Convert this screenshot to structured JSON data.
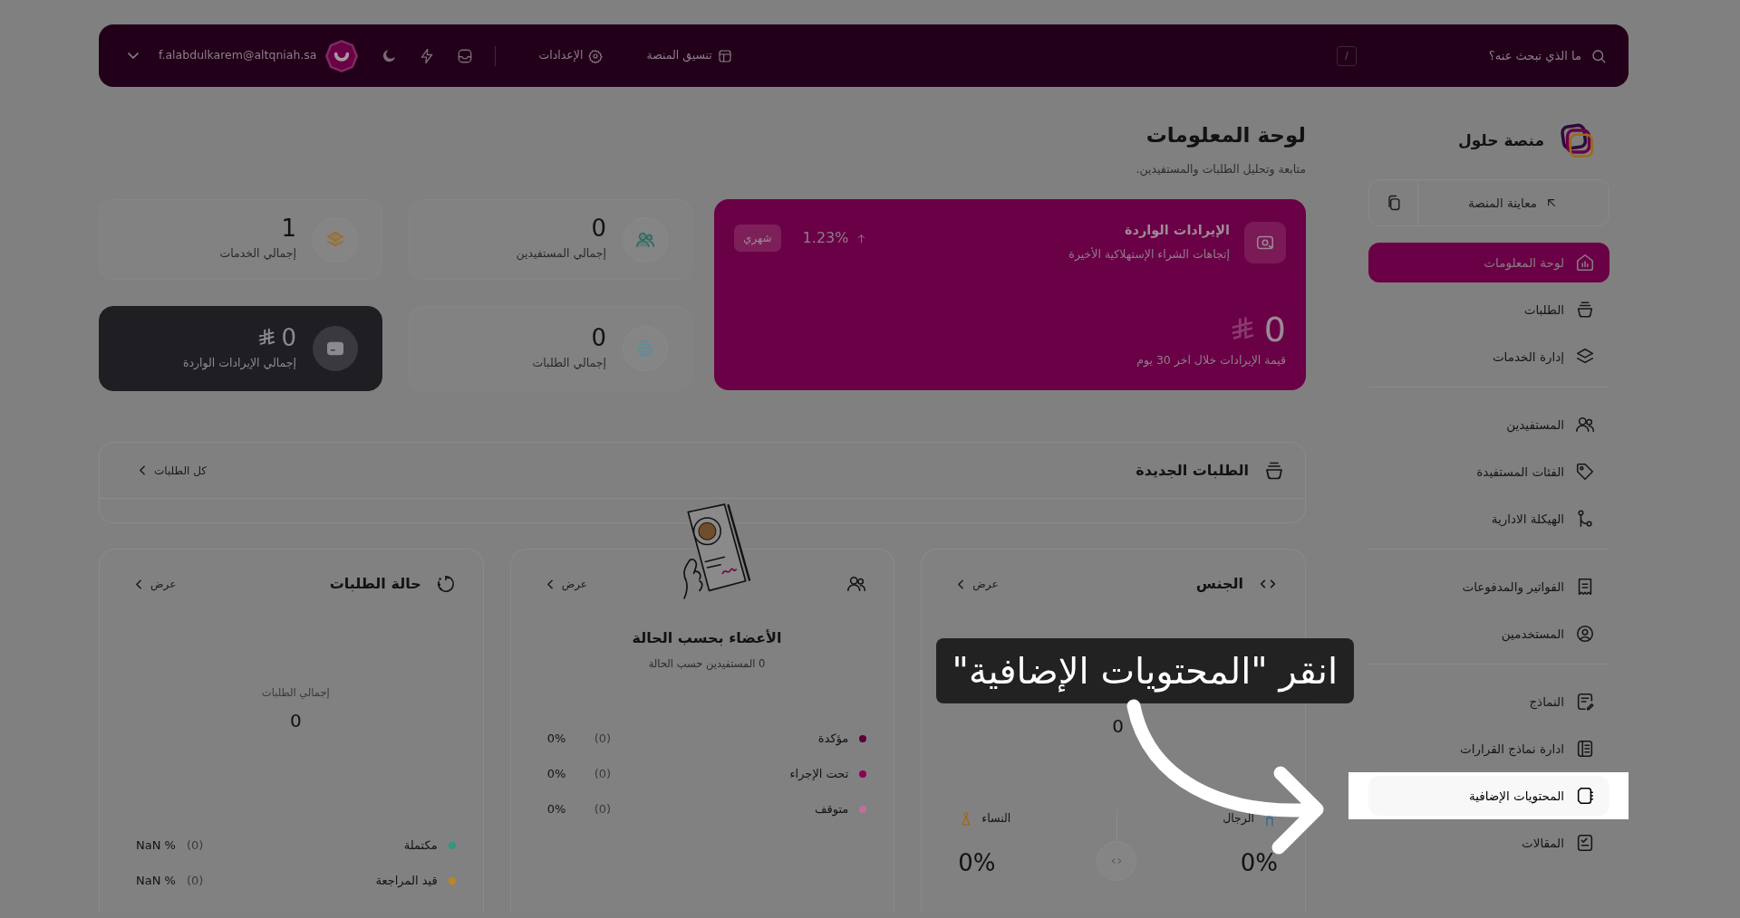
{
  "top_bar": {
    "search": {
      "placeholder": "ما الذي تبحث عنه؟"
    },
    "shortcut_key": "/",
    "links": [
      {
        "label": "تنسيق المنصة"
      },
      {
        "label": "الإعدادات"
      }
    ],
    "user": {
      "email": "f.alabdulkarem@altqniah.sa"
    }
  },
  "sidebar": {
    "brand": "منصة حلول",
    "preview_button": "معاينة المنصة",
    "groups": [
      {
        "items": [
          {
            "label": "لوحة المعلومات",
            "selected": true,
            "highlighted": false
          },
          {
            "label": "الطلبات",
            "selected": false,
            "highlighted": false
          },
          {
            "label": "إدارة الخدمات",
            "selected": false,
            "highlighted": false
          }
        ]
      },
      {
        "items": [
          {
            "label": "المستفيدين",
            "selected": false,
            "highlighted": false
          },
          {
            "label": "الفئات المستفيدة",
            "selected": false,
            "highlighted": false
          },
          {
            "label": "الهيكلة الادارية",
            "selected": false,
            "highlighted": false
          }
        ]
      },
      {
        "items": [
          {
            "label": "الفواتير والمدفوعات",
            "selected": false,
            "highlighted": false
          },
          {
            "label": "المستخدمين",
            "selected": false,
            "highlighted": false
          }
        ]
      },
      {
        "items": [
          {
            "label": "النماذج",
            "selected": false,
            "highlighted": false
          },
          {
            "label": "ادارة نماذج القرارات",
            "selected": false,
            "highlighted": false
          },
          {
            "label": "المحتويات الإضافية",
            "selected": false,
            "highlighted": true
          },
          {
            "label": "المقالات",
            "selected": false,
            "highlighted": false
          }
        ]
      }
    ]
  },
  "page": {
    "title": "لوحة المعلومات",
    "subtitle": "متابعة وتحليل الطلبات والمستفيدين."
  },
  "revenue_card": {
    "title": "الإيرادات الواردة",
    "subtitle": "إتجاهات الشراء الإستهلاكية الأخيرة",
    "change": "1.23%",
    "period": "شهري",
    "value": "0",
    "caption": "قيمة الإيرادات خلال اخر 30 يوم"
  },
  "stats": [
    {
      "kind": "count",
      "value": "0",
      "label": "إجمالي المستفيدين"
    },
    {
      "kind": "count",
      "value": "1",
      "label": "إجمالي الخدمات"
    },
    {
      "kind": "count",
      "value": "0",
      "label": "إجمالي الطلبات"
    },
    {
      "kind": "revenue",
      "value": "0",
      "label": "إجمالي الإيرادات الواردة"
    }
  ],
  "new_orders": {
    "title": "الطلبات الجديدة",
    "link": "كل الطلبات"
  },
  "gender_card": {
    "title": "الجنس",
    "link": "عرض",
    "total": "0",
    "men": {
      "label": "الرجال",
      "percent": "0%"
    },
    "women": {
      "label": "النساء",
      "percent": "0%"
    }
  },
  "members_card": {
    "link": "عرض",
    "title": "الأعضاء بحسب الحالة",
    "subtitle": "0 المستفيدين حسب الحالة",
    "legend": [
      {
        "label": "مؤكدة",
        "count": "(0)",
        "percent": "0%",
        "color": "#5c0038"
      },
      {
        "label": "تحت الإجراء",
        "count": "(0)",
        "percent": "0%",
        "color": "#8c0058"
      },
      {
        "label": "متوقف",
        "count": "(0)",
        "percent": "0%",
        "color": "#c0709e"
      }
    ]
  },
  "status_card": {
    "title": "حالة الطلبات",
    "link": "عرض",
    "total_label": "إجمالي الطلبات",
    "total": "0",
    "legend": [
      {
        "label": "مكتملة",
        "count": "(0)",
        "percent": "% NaN",
        "color": "#2e9a80"
      },
      {
        "label": "قيد المراجعة",
        "count": "(0)",
        "percent": "% NaN",
        "color": "#c0861c"
      }
    ]
  },
  "tutorial": {
    "callout": "انقر \"المحتويات الإضافية\""
  }
}
